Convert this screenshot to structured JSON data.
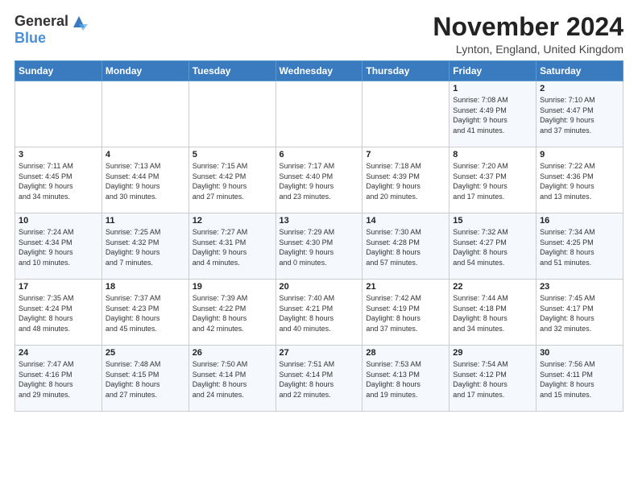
{
  "logo": {
    "general": "General",
    "blue": "Blue"
  },
  "header": {
    "month": "November 2024",
    "location": "Lynton, England, United Kingdom"
  },
  "weekdays": [
    "Sunday",
    "Monday",
    "Tuesday",
    "Wednesday",
    "Thursday",
    "Friday",
    "Saturday"
  ],
  "weeks": [
    [
      {
        "day": "",
        "info": ""
      },
      {
        "day": "",
        "info": ""
      },
      {
        "day": "",
        "info": ""
      },
      {
        "day": "",
        "info": ""
      },
      {
        "day": "",
        "info": ""
      },
      {
        "day": "1",
        "info": "Sunrise: 7:08 AM\nSunset: 4:49 PM\nDaylight: 9 hours\nand 41 minutes."
      },
      {
        "day": "2",
        "info": "Sunrise: 7:10 AM\nSunset: 4:47 PM\nDaylight: 9 hours\nand 37 minutes."
      }
    ],
    [
      {
        "day": "3",
        "info": "Sunrise: 7:11 AM\nSunset: 4:45 PM\nDaylight: 9 hours\nand 34 minutes."
      },
      {
        "day": "4",
        "info": "Sunrise: 7:13 AM\nSunset: 4:44 PM\nDaylight: 9 hours\nand 30 minutes."
      },
      {
        "day": "5",
        "info": "Sunrise: 7:15 AM\nSunset: 4:42 PM\nDaylight: 9 hours\nand 27 minutes."
      },
      {
        "day": "6",
        "info": "Sunrise: 7:17 AM\nSunset: 4:40 PM\nDaylight: 9 hours\nand 23 minutes."
      },
      {
        "day": "7",
        "info": "Sunrise: 7:18 AM\nSunset: 4:39 PM\nDaylight: 9 hours\nand 20 minutes."
      },
      {
        "day": "8",
        "info": "Sunrise: 7:20 AM\nSunset: 4:37 PM\nDaylight: 9 hours\nand 17 minutes."
      },
      {
        "day": "9",
        "info": "Sunrise: 7:22 AM\nSunset: 4:36 PM\nDaylight: 9 hours\nand 13 minutes."
      }
    ],
    [
      {
        "day": "10",
        "info": "Sunrise: 7:24 AM\nSunset: 4:34 PM\nDaylight: 9 hours\nand 10 minutes."
      },
      {
        "day": "11",
        "info": "Sunrise: 7:25 AM\nSunset: 4:32 PM\nDaylight: 9 hours\nand 7 minutes."
      },
      {
        "day": "12",
        "info": "Sunrise: 7:27 AM\nSunset: 4:31 PM\nDaylight: 9 hours\nand 4 minutes."
      },
      {
        "day": "13",
        "info": "Sunrise: 7:29 AM\nSunset: 4:30 PM\nDaylight: 9 hours\nand 0 minutes."
      },
      {
        "day": "14",
        "info": "Sunrise: 7:30 AM\nSunset: 4:28 PM\nDaylight: 8 hours\nand 57 minutes."
      },
      {
        "day": "15",
        "info": "Sunrise: 7:32 AM\nSunset: 4:27 PM\nDaylight: 8 hours\nand 54 minutes."
      },
      {
        "day": "16",
        "info": "Sunrise: 7:34 AM\nSunset: 4:25 PM\nDaylight: 8 hours\nand 51 minutes."
      }
    ],
    [
      {
        "day": "17",
        "info": "Sunrise: 7:35 AM\nSunset: 4:24 PM\nDaylight: 8 hours\nand 48 minutes."
      },
      {
        "day": "18",
        "info": "Sunrise: 7:37 AM\nSunset: 4:23 PM\nDaylight: 8 hours\nand 45 minutes."
      },
      {
        "day": "19",
        "info": "Sunrise: 7:39 AM\nSunset: 4:22 PM\nDaylight: 8 hours\nand 42 minutes."
      },
      {
        "day": "20",
        "info": "Sunrise: 7:40 AM\nSunset: 4:21 PM\nDaylight: 8 hours\nand 40 minutes."
      },
      {
        "day": "21",
        "info": "Sunrise: 7:42 AM\nSunset: 4:19 PM\nDaylight: 8 hours\nand 37 minutes."
      },
      {
        "day": "22",
        "info": "Sunrise: 7:44 AM\nSunset: 4:18 PM\nDaylight: 8 hours\nand 34 minutes."
      },
      {
        "day": "23",
        "info": "Sunrise: 7:45 AM\nSunset: 4:17 PM\nDaylight: 8 hours\nand 32 minutes."
      }
    ],
    [
      {
        "day": "24",
        "info": "Sunrise: 7:47 AM\nSunset: 4:16 PM\nDaylight: 8 hours\nand 29 minutes."
      },
      {
        "day": "25",
        "info": "Sunrise: 7:48 AM\nSunset: 4:15 PM\nDaylight: 8 hours\nand 27 minutes."
      },
      {
        "day": "26",
        "info": "Sunrise: 7:50 AM\nSunset: 4:14 PM\nDaylight: 8 hours\nand 24 minutes."
      },
      {
        "day": "27",
        "info": "Sunrise: 7:51 AM\nSunset: 4:14 PM\nDaylight: 8 hours\nand 22 minutes."
      },
      {
        "day": "28",
        "info": "Sunrise: 7:53 AM\nSunset: 4:13 PM\nDaylight: 8 hours\nand 19 minutes."
      },
      {
        "day": "29",
        "info": "Sunrise: 7:54 AM\nSunset: 4:12 PM\nDaylight: 8 hours\nand 17 minutes."
      },
      {
        "day": "30",
        "info": "Sunrise: 7:56 AM\nSunset: 4:11 PM\nDaylight: 8 hours\nand 15 minutes."
      }
    ]
  ]
}
